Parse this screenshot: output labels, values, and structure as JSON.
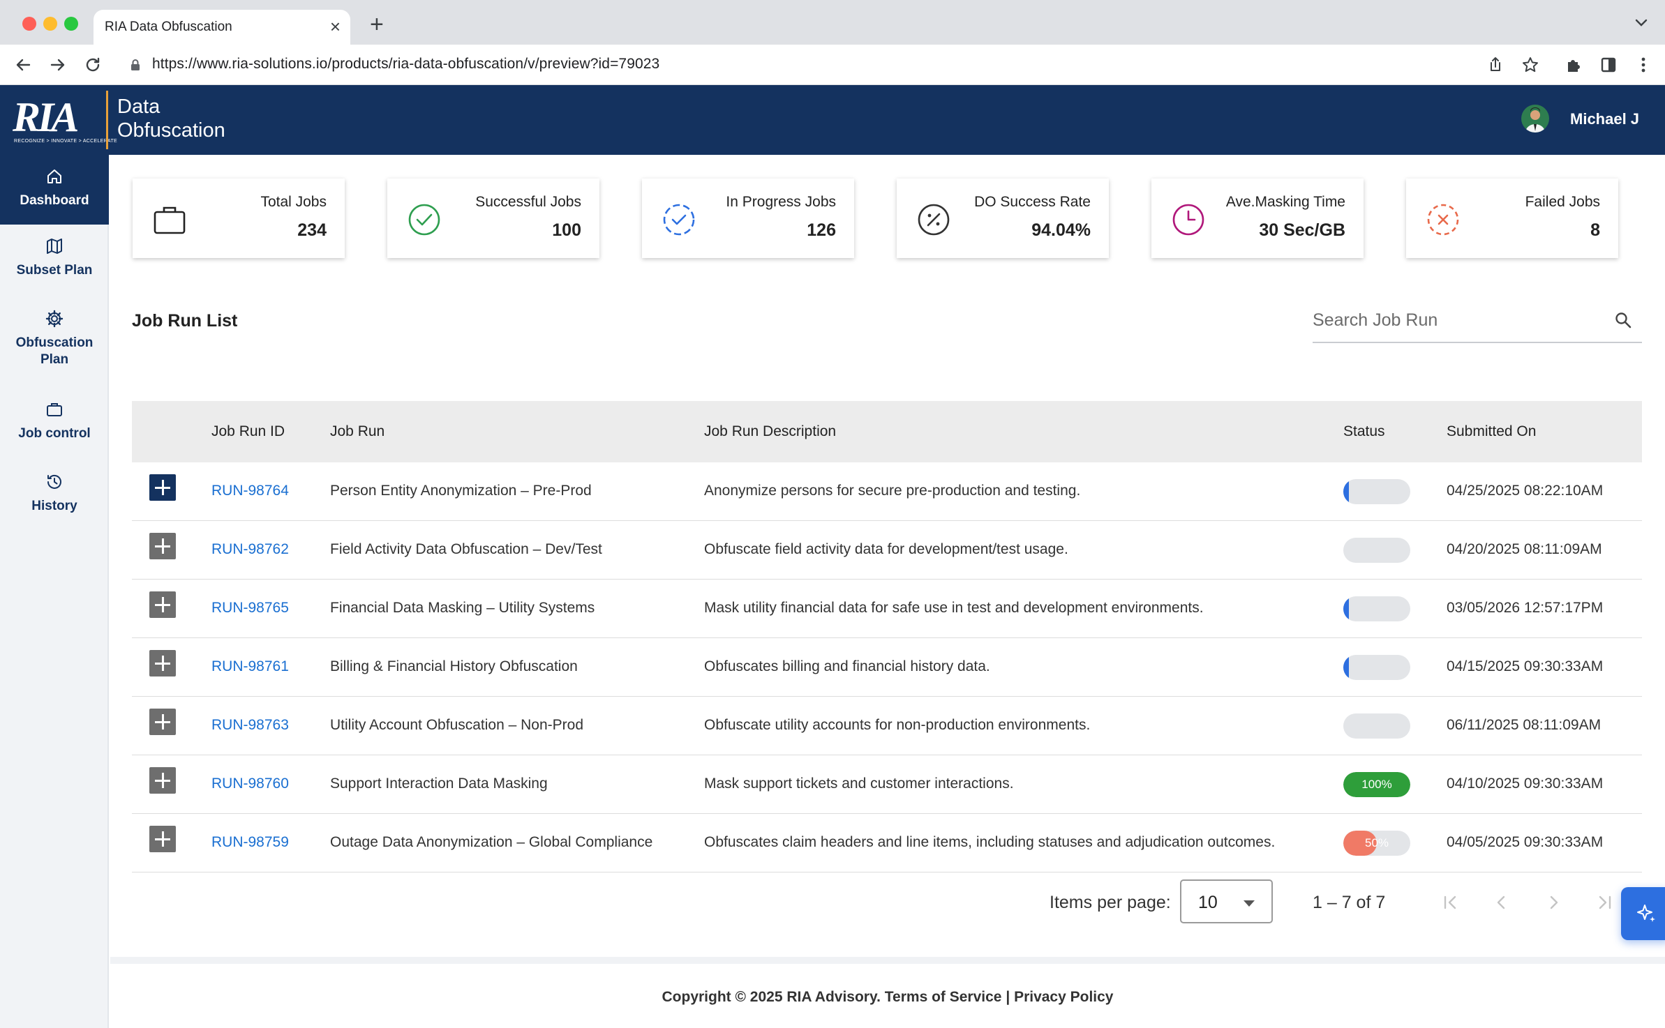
{
  "browser": {
    "tab_title": "RIA Data Obfuscation",
    "url": "https://www.ria-solutions.io/products/ria-data-obfuscation/v/preview?id=79023"
  },
  "header": {
    "logo_text": "RIA",
    "logo_tagline": "RECOGNIZE > INNOVATE > ACCELERATE",
    "product_line1": "Data",
    "product_line2": "Obfuscation",
    "user_name": "Michael J"
  },
  "sidebar": {
    "items": [
      {
        "label": "Dashboard",
        "icon": "home-icon",
        "active": true
      },
      {
        "label": "Subset Plan",
        "icon": "map-icon"
      },
      {
        "label": "Obfuscation",
        "label2": "Plan",
        "icon": "gear-icon"
      },
      {
        "label": "Job control",
        "icon": "briefcase-icon"
      },
      {
        "label": "History",
        "icon": "history-icon"
      }
    ]
  },
  "stats": [
    {
      "label": "Total Jobs",
      "value": "234",
      "icon": "briefcase-icon",
      "color": "#222222"
    },
    {
      "label": "Successful Jobs",
      "value": "100",
      "icon": "check-circle-icon",
      "color": "#2e9e4f"
    },
    {
      "label": "In Progress Jobs",
      "value": "126",
      "icon": "progress-check-icon",
      "color": "#2d6fe0"
    },
    {
      "label": "DO Success Rate",
      "value": "94.04%",
      "icon": "percent-icon",
      "color": "#333333"
    },
    {
      "label": "Ave.Masking Time",
      "value": "30 Sec/GB",
      "icon": "clock-icon",
      "color": "#b0177a"
    },
    {
      "label": "Failed Jobs",
      "value": "8",
      "icon": "failed-icon",
      "color": "#e8694a"
    }
  ],
  "job_list": {
    "title": "Job Run List",
    "search_placeholder": "Search Job Run",
    "columns": {
      "id": "Job Run ID",
      "run": "Job Run",
      "desc": "Job Run Description",
      "status": "Status",
      "submitted": "Submitted On"
    },
    "rows": [
      {
        "id": "RUN-98764",
        "run": "Person Entity Anonymization – Pre-Prod",
        "desc": "Anonymize persons for secure pre-production and testing.",
        "progress": 0.08,
        "status_text": "",
        "color": "#2d6fe0",
        "submitted": "04/25/2025 08:22:10AM",
        "expanded": true
      },
      {
        "id": "RUN-98762",
        "run": "Field Activity Data Obfuscation – Dev/Test",
        "desc": "Obfuscate field activity data for development/test usage.",
        "progress": 0,
        "status_text": "",
        "color": "#2d6fe0",
        "submitted": "04/20/2025 08:11:09AM"
      },
      {
        "id": "RUN-98765",
        "run": "Financial Data Masking – Utility Systems",
        "desc": "Mask utility financial data for safe use in test and development environments.",
        "progress": 0.08,
        "status_text": "",
        "color": "#2d6fe0",
        "submitted": "03/05/2026 12:57:17PM"
      },
      {
        "id": "RUN-98761",
        "run": "Billing & Financial History Obfuscation",
        "desc": "Obfuscates billing and financial history data.",
        "progress": 0.08,
        "status_text": "",
        "color": "#2d6fe0",
        "submitted": "04/15/2025 09:30:33AM"
      },
      {
        "id": "RUN-98763",
        "run": "Utility Account Obfuscation – Non-Prod",
        "desc": "Obfuscate utility accounts for non-production environments.",
        "progress": 0,
        "status_text": "",
        "color": "#2d6fe0",
        "submitted": "06/11/2025 08:11:09AM"
      },
      {
        "id": "RUN-98760",
        "run": "Support Interaction Data Masking",
        "desc": "Mask support tickets and customer interactions.",
        "progress": 1.0,
        "status_text": "100%",
        "color": "#2e9e3a",
        "submitted": "04/10/2025 09:30:33AM"
      },
      {
        "id": "RUN-98759",
        "run": "Outage Data Anonymization – Global Compliance",
        "desc": "Obfuscates claim headers and line items, including statuses and adjudication outcomes.",
        "progress": 0.5,
        "status_text": "50%",
        "color": "#f07a66",
        "submitted": "04/05/2025 09:30:33AM"
      }
    ]
  },
  "pagination": {
    "items_per_page_label": "Items per page:",
    "items_per_page": "10",
    "range": "1 – 7 of 7"
  },
  "footer": {
    "copyright": "Copyright © 2025 RIA Advisory.",
    "terms": "Terms of Service",
    "separator": "|",
    "privacy": "Privacy Policy"
  }
}
